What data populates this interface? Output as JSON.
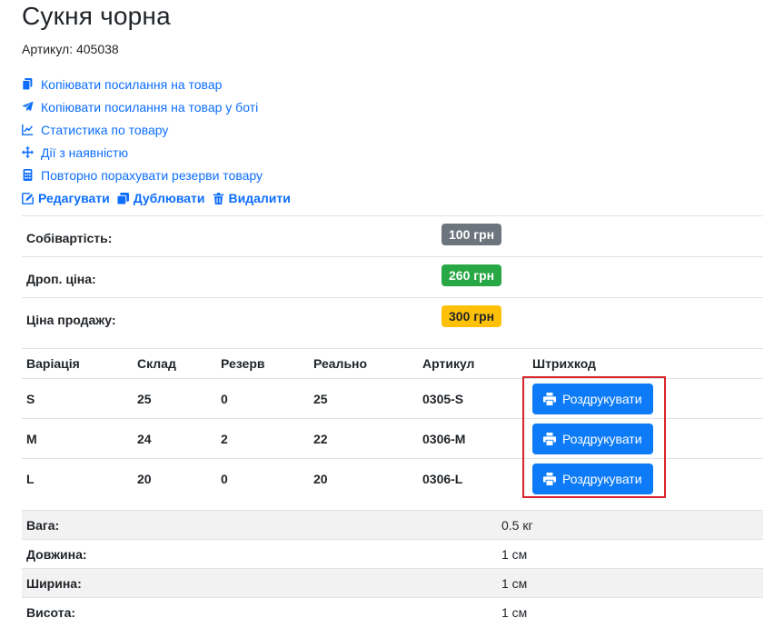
{
  "product": {
    "title": "Сукня чорна",
    "sku_label": "Артикул: 405038"
  },
  "links": [
    {
      "label": "Копіювати посилання на товар",
      "icon": "copy-icon"
    },
    {
      "label": "Копіювати посилання на товар у боті",
      "icon": "telegram-plane-icon"
    },
    {
      "label": "Статистика по товару",
      "icon": "chart-line-icon"
    },
    {
      "label": "Дії з наявністю",
      "icon": "arrows-move-icon"
    },
    {
      "label": "Повторно порахувати резерви товару",
      "icon": "calculator-icon"
    }
  ],
  "actions": {
    "edit": "Редагувати",
    "duplicate": "Дублювати",
    "delete": "Видалити"
  },
  "prices": [
    {
      "label": "Собівартість:",
      "value": "100 грн",
      "color": "#6c757d"
    },
    {
      "label": "Дроп. ціна:",
      "value": "260 грн",
      "color": "#28a745"
    },
    {
      "label": "Ціна продажу:",
      "value": "300 грн",
      "color": "#ffc107"
    }
  ],
  "variations": {
    "headers": [
      "Варіація",
      "Склад",
      "Резерв",
      "Реально",
      "Артикул",
      "Штрихкод"
    ],
    "print_label": "Роздрукувати",
    "rows": [
      {
        "name": "S",
        "stock": "25",
        "reserve": "0",
        "real": "25",
        "sku": "0305-S"
      },
      {
        "name": "M",
        "stock": "24",
        "reserve": "2",
        "real": "22",
        "sku": "0306-M"
      },
      {
        "name": "L",
        "stock": "20",
        "reserve": "0",
        "real": "20",
        "sku": "0306-L"
      }
    ]
  },
  "dimensions": [
    {
      "label": "Вага:",
      "value": "0.5 кг"
    },
    {
      "label": "Довжина:",
      "value": "1 см"
    },
    {
      "label": "Ширина:",
      "value": "1 см"
    },
    {
      "label": "Висота:",
      "value": "1 см"
    }
  ],
  "colors": {
    "link": "#0d6efd",
    "button": "#0d7bf7",
    "highlight": "#d9252b"
  }
}
